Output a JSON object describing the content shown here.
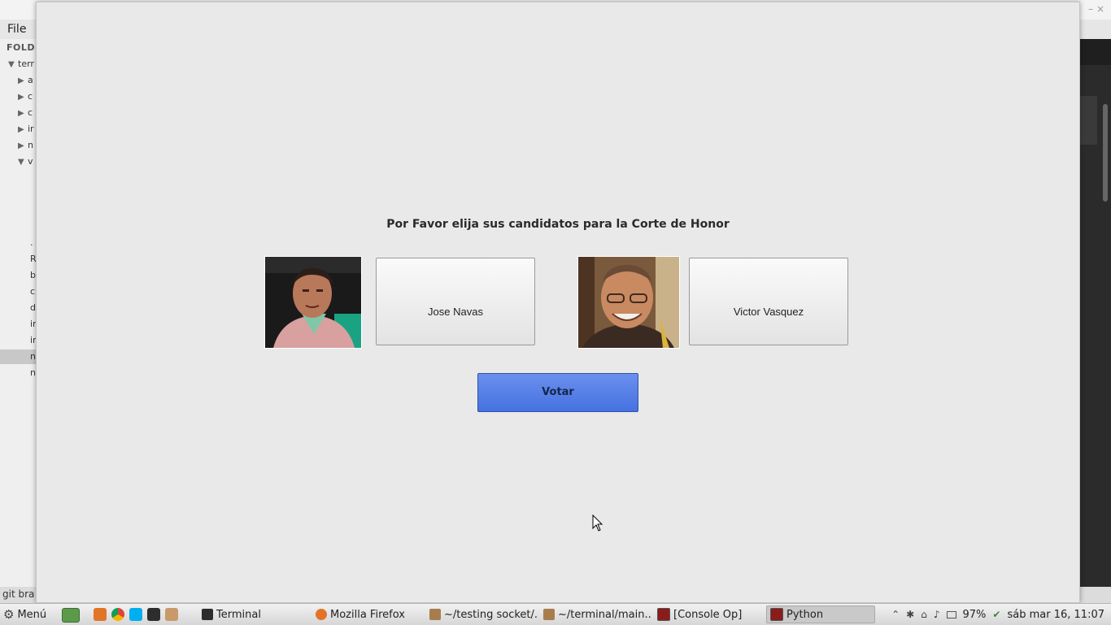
{
  "background_app": {
    "menu_file": "File",
    "sidebar_header": "FOLD",
    "tree": [
      {
        "label": "terr",
        "expanded": true
      },
      {
        "label": "a",
        "expanded": false
      },
      {
        "label": "c",
        "expanded": false
      },
      {
        "label": "c",
        "expanded": false
      },
      {
        "label": "ir",
        "expanded": false
      },
      {
        "label": "n",
        "expanded": false
      },
      {
        "label": "v",
        "expanded": true
      }
    ],
    "files": [
      ".",
      "R",
      "b",
      "c",
      "d",
      "ir",
      "ir",
      "n",
      "n"
    ],
    "status_text": "git bra"
  },
  "dialog": {
    "prompt": "Por Favor elija sus candidatos para la Corte de Honor",
    "candidates": [
      {
        "name": "Jose Navas",
        "photo": "candidate-photo"
      },
      {
        "name": "Victor Vasquez",
        "photo": "candidate-photo"
      }
    ],
    "vote_label": "Votar"
  },
  "taskbar": {
    "menu_label": "Menú",
    "launchers": [
      "file-manager-icon",
      "firefox-icon",
      "chrome-icon",
      "skype-icon",
      "terminal-icon",
      "gimp-icon"
    ],
    "tasks": [
      {
        "label": "Terminal",
        "icon": "terminal-icon",
        "active": false
      },
      {
        "label": "Mozilla Firefox",
        "icon": "firefox-icon",
        "active": false
      },
      {
        "label": "~/testing socket/...",
        "icon": "text-editor-icon",
        "active": false
      },
      {
        "label": "~/terminal/main....",
        "icon": "text-editor-icon",
        "active": false
      },
      {
        "label": "[Console Op]",
        "icon": "console-icon",
        "active": false
      },
      {
        "label": "Python",
        "icon": "python-window-icon",
        "active": true
      }
    ],
    "battery": "97%",
    "clock": "sáb mar 16, 11:07"
  },
  "colors": {
    "vote_button": "#4f7ae6",
    "dialog_bg": "#e9e9e9",
    "taskbar_bg": "#e2e2e2"
  }
}
